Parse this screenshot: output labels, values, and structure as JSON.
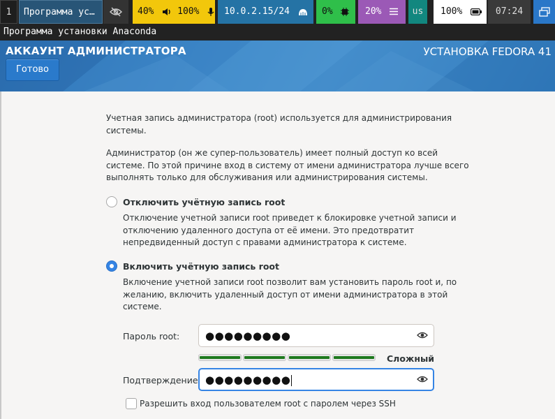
{
  "topbar": {
    "workspace": "1",
    "window_title": "Программа ус…",
    "volume": "40%",
    "mic": "100%",
    "ip": "10.0.2.15/24",
    "cpu": "0%",
    "memory": "20%",
    "keyboard_layout": "us",
    "battery": "100%",
    "clock": "07:24",
    "colors": {
      "workspace_bg": "#1e1e1e",
      "title_bg": "#285577",
      "visibility_bg": "#333333",
      "audio_bg": "#f2c70b",
      "network_bg": "#2573a5",
      "cpu_bg": "#2fbf4a",
      "memory_bg": "#9b59b6",
      "layout_bg": "#12877f",
      "battery_bg": "#ffffff",
      "clock_bg": "#3a3a3a",
      "windows_bg": "#2a77c8"
    },
    "icons": [
      "eye-slash-icon",
      "volume-icon",
      "microphone-icon",
      "network-icon",
      "cpu-chip-icon",
      "menu-lines-icon",
      "battery-icon",
      "windows-icon"
    ]
  },
  "window": {
    "title": "Программа установки Anaconda"
  },
  "header": {
    "spoke_title": "АККАУНТ АДМИНИСТРАТОРА",
    "product_title": "УСТАНОВКА FEDORA 41",
    "done_label": "Готово"
  },
  "content": {
    "intro_line1": "Учетная запись администратора (root) используется для администрирования",
    "intro_line2": "системы.",
    "desc_line1": "Администратор (он же супер-пользователь) имеет полный доступ ко всей",
    "desc_line2": "системе. По этой причине вход в систему от имени администратора лучше всего",
    "desc_line3": "выполнять только для обслуживания или администрирования системы.",
    "disable_option": {
      "label": "Отключить учётную запись root",
      "checked": false,
      "desc_line1": "Отключение учетной записи root приведет к блокировке учетной записи и",
      "desc_line2": "отключению удаленного доступа от её имени. Это предотвратит",
      "desc_line3": "непредвиденный доступ с правами администратора к системе."
    },
    "enable_option": {
      "label": "Включить учётную запись root",
      "checked": true,
      "desc_line1": "Включение учетной записи root позволит вам установить пароль root и, по",
      "desc_line2": "желанию, включить удаленный доступ от имени администратора в этой",
      "desc_line3": "системе."
    },
    "password_label": "Пароль root:",
    "password_value": "●●●●●●●●●",
    "confirm_label": "Подтверждение:",
    "confirm_value": "●●●●●●●●●",
    "strength_label": "Сложный",
    "strength_level": 1.0,
    "ssh_label": "Разрешить вход пользователем root с паролем через SSH",
    "ssh_checked": false
  }
}
